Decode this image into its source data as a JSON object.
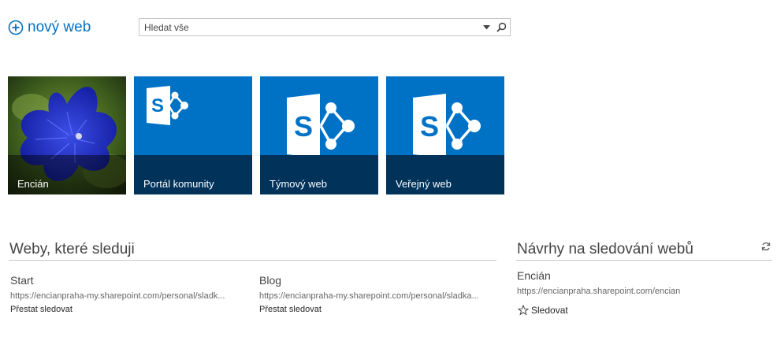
{
  "header": {
    "new_site_label": "nový web",
    "search_placeholder": "Hledat vše"
  },
  "tiles": [
    {
      "title": "Encián"
    },
    {
      "title": "Portál komunity"
    },
    {
      "title": "Týmový web"
    },
    {
      "title": "Veřejný web"
    }
  ],
  "followed": {
    "heading": "Weby, které sleduji",
    "sites": [
      {
        "name": "Start",
        "url": "https://encianpraha-my.sharepoint.com/personal/sladk...",
        "action": "Přestat sledovat"
      },
      {
        "name": "Blog",
        "url": "https://encianpraha-my.sharepoint.com/personal/sladka...",
        "action": "Přestat sledovat"
      }
    ]
  },
  "suggestions": {
    "heading": "Návrhy na sledování webů",
    "site": {
      "name": "Encián",
      "url": "https://encianpraha.sharepoint.com/encian",
      "action": "Sledovat"
    }
  },
  "colors": {
    "accent": "#0072c6",
    "tile_band": "#00325a"
  }
}
